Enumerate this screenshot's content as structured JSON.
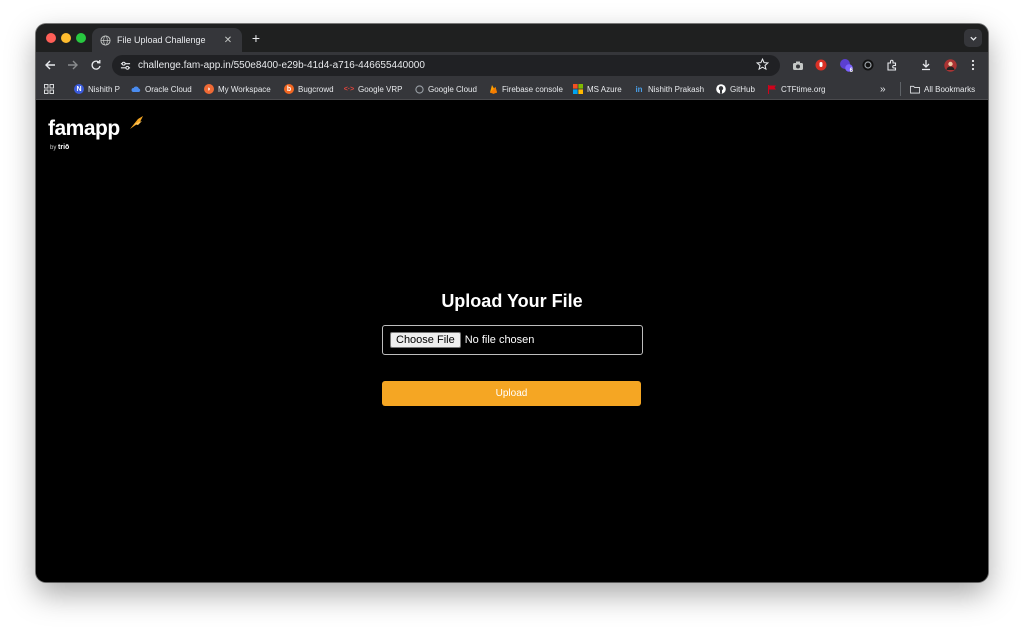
{
  "tab": {
    "title": "File Upload Challenge",
    "close": "✕",
    "new_tab": "+"
  },
  "toolbar": {
    "url": "challenge.fam-app.in/550e8400-e29b-41d4-a716-446655440000",
    "extension_badge": "6"
  },
  "bookmarks": [
    {
      "label": "Nishith P",
      "icon_color": "#3b5bdb"
    },
    {
      "label": "Oracle Cloud",
      "icon_color": "#4a8cf0"
    },
    {
      "label": "My Workspace",
      "icon_color": "#f06a35"
    },
    {
      "label": "Bugcrowd",
      "icon_color": "#f26722"
    },
    {
      "label": "Google VRP",
      "icon_color": "#e8453c"
    },
    {
      "label": "Google Cloud",
      "icon_color": "#9aa0a6"
    },
    {
      "label": "Firebase console",
      "icon_color": "#ffa000"
    },
    {
      "label": "MS Azure",
      "icon_color": "#f25022"
    },
    {
      "label": "Nishith Prakash",
      "icon_color": "#0a66c2"
    },
    {
      "label": "GitHub",
      "icon_color": "#ffffff"
    },
    {
      "label": "CTFtime.org",
      "icon_color": "#d0021b"
    }
  ],
  "bookmarks_overflow": "»",
  "all_bookmarks": "All Bookmarks",
  "logo": {
    "brand": "famapp",
    "by": "by",
    "sub": "triō"
  },
  "main": {
    "heading": "Upload Your File",
    "choose_file": "Choose File",
    "no_file": "No file chosen",
    "upload_label": "Upload"
  },
  "colors": {
    "accent": "#f5a623",
    "page_bg": "#000000",
    "chrome": "#35363a"
  }
}
